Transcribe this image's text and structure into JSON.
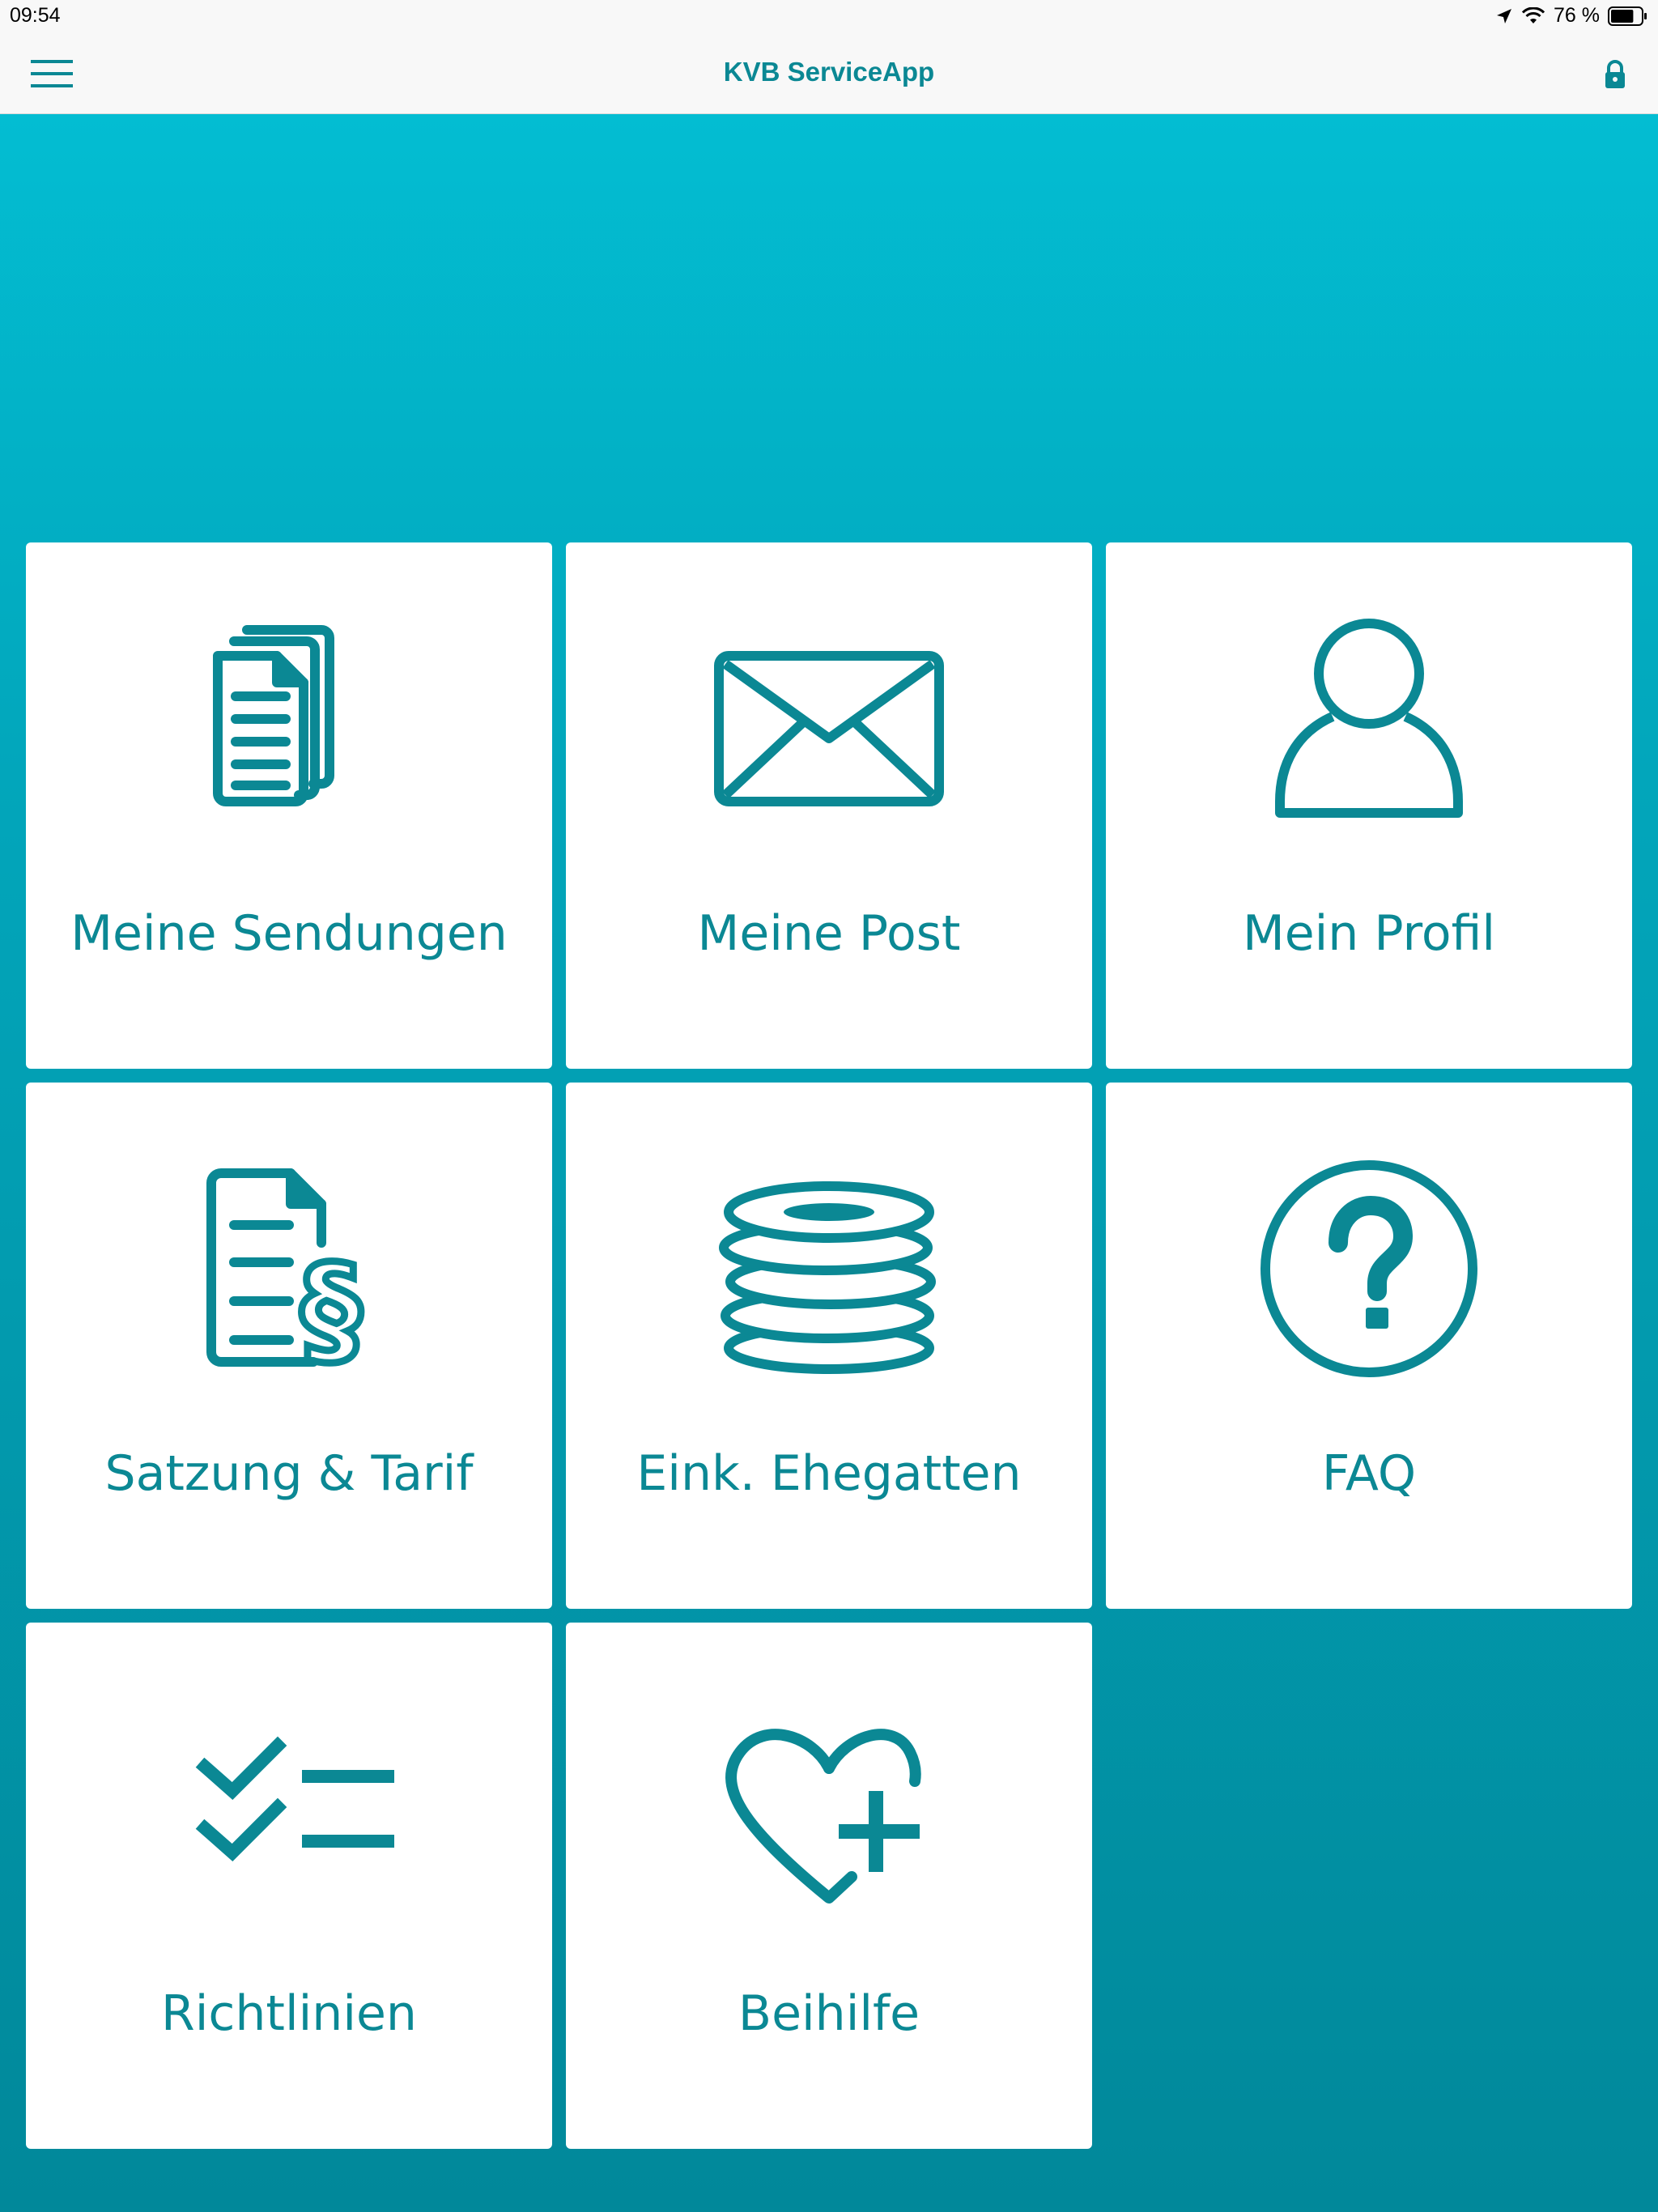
{
  "status_bar": {
    "time": "09:54",
    "battery_percent": "76 %",
    "battery_level": 0.76
  },
  "nav": {
    "title": "KVB ServiceApp",
    "menu_icon": "hamburger-menu-icon",
    "lock_icon": "lock-icon"
  },
  "tiles": [
    {
      "label": "Meine Sendungen",
      "icon": "documents-stack-icon"
    },
    {
      "label": "Meine Post",
      "icon": "envelope-icon"
    },
    {
      "label": "Mein Profil",
      "icon": "person-icon"
    },
    {
      "label": "Satzung & Tarif",
      "icon": "document-paragraph-icon"
    },
    {
      "label": "Eink. Ehegatten",
      "icon": "coins-stack-icon"
    },
    {
      "label": "FAQ",
      "icon": "question-circle-icon"
    },
    {
      "label": "Richtlinien",
      "icon": "checklist-icon"
    },
    {
      "label": "Beihilfe",
      "icon": "heart-plus-icon"
    }
  ],
  "colors": {
    "accent": "#0b8894",
    "background_top": "#03c1d6",
    "background_bottom": "#01889a",
    "tile": "#ffffff"
  }
}
